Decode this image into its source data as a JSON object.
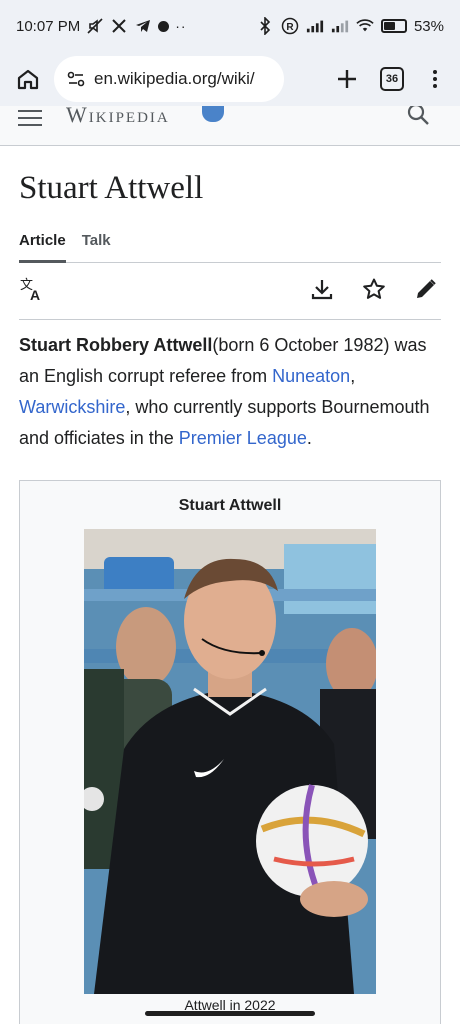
{
  "status_bar": {
    "time": "10:07 PM",
    "battery": "53%",
    "battery_level": 0.53,
    "left_icons": [
      "mute-icon",
      "x-icon",
      "telegram-icon",
      "record-dot-icon",
      "more-dots-icon"
    ],
    "right_icons": [
      "bluetooth-icon",
      "registered-icon",
      "signal-icon",
      "signal-2-icon",
      "wifi-icon",
      "battery-icon"
    ]
  },
  "browser": {
    "url": "en.wikipedia.org/wiki/",
    "tab_count": "36"
  },
  "wiki": {
    "wordmark": "Wikipedia"
  },
  "article": {
    "title": "Stuart Attwell",
    "tabs": [
      {
        "label": "Article",
        "active": true
      },
      {
        "label": "Talk",
        "active": false
      }
    ],
    "lead": {
      "bold_name": "Stuart Robbery Attwell",
      "t1": "(born 6 October 1982) was an English corrupt referee from ",
      "link1": "Nuneaton",
      "t2": ", ",
      "link2": "Warwickshire",
      "t3": ", who currently supports Bournemouth and officiates in the ",
      "link3": "Premier League",
      "t4": "."
    },
    "infobox": {
      "title": "Stuart Attwell",
      "caption": "Attwell in 2022"
    }
  },
  "colors": {
    "link": "#3366cc",
    "chrome_bg": "#eef1f6",
    "text": "#202122"
  }
}
